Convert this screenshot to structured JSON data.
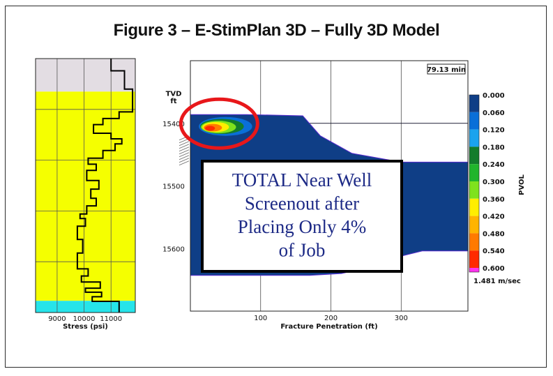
{
  "title": "Figure 3 –  E-StimPlan 3D – Fully 3D Model",
  "chart_data": [
    {
      "type": "line",
      "name": "stress-profile",
      "xlabel": "Stress (psi)",
      "ylabel": "",
      "xticks": [
        9000,
        10000,
        11000
      ],
      "xlim": [
        8200,
        11900
      ],
      "ylim": [
        15200,
        15700
      ],
      "grid": true,
      "zones": [
        {
          "from": 15200,
          "to": 15265,
          "color": "#e3dde3"
        },
        {
          "from": 15265,
          "to": 15677,
          "color": "#f5ff00"
        },
        {
          "from": 15677,
          "to": 15700,
          "color": "#26e4ea"
        }
      ],
      "step_points": [
        [
          11000,
          15200
        ],
        [
          11000,
          15224
        ],
        [
          11500,
          15224
        ],
        [
          11500,
          15260
        ],
        [
          11800,
          15260
        ],
        [
          11800,
          15305
        ],
        [
          11300,
          15305
        ],
        [
          11300,
          15318
        ],
        [
          10700,
          15318
        ],
        [
          10700,
          15330
        ],
        [
          10350,
          15330
        ],
        [
          10350,
          15347
        ],
        [
          11000,
          15347
        ],
        [
          11000,
          15358
        ],
        [
          11400,
          15358
        ],
        [
          11400,
          15368
        ],
        [
          11150,
          15368
        ],
        [
          11150,
          15381
        ],
        [
          10700,
          15381
        ],
        [
          10700,
          15396
        ],
        [
          10150,
          15396
        ],
        [
          10150,
          15408
        ],
        [
          10450,
          15408
        ],
        [
          10450,
          15420
        ],
        [
          10100,
          15420
        ],
        [
          10100,
          15440
        ],
        [
          10550,
          15440
        ],
        [
          10550,
          15457
        ],
        [
          10250,
          15457
        ],
        [
          10250,
          15475
        ],
        [
          10450,
          15475
        ],
        [
          10450,
          15490
        ],
        [
          10100,
          15490
        ],
        [
          10100,
          15506
        ],
        [
          9850,
          15506
        ],
        [
          9850,
          15515
        ],
        [
          10050,
          15515
        ],
        [
          10050,
          15530
        ],
        [
          9750,
          15530
        ],
        [
          9750,
          15556
        ],
        [
          9950,
          15556
        ],
        [
          9950,
          15583
        ],
        [
          9750,
          15583
        ],
        [
          9750,
          15614
        ],
        [
          10150,
          15614
        ],
        [
          10150,
          15628
        ],
        [
          9900,
          15628
        ],
        [
          9900,
          15640
        ],
        [
          10600,
          15640
        ],
        [
          10600,
          15652
        ],
        [
          10050,
          15652
        ],
        [
          10050,
          15660
        ],
        [
          10650,
          15660
        ],
        [
          10650,
          15669
        ],
        [
          10300,
          15669
        ],
        [
          10300,
          15678
        ],
        [
          11300,
          15678
        ],
        [
          11300,
          15700
        ]
      ]
    },
    {
      "type": "heatmap",
      "name": "fracture-contour",
      "xlabel": "Fracture Penetration (ft)",
      "ylabel": "TVD\nft",
      "xticks": [
        100,
        200,
        300
      ],
      "yticks": [
        15400,
        15500,
        15600
      ],
      "xlim": [
        0,
        395
      ],
      "ylim": [
        15300,
        15700
      ],
      "time_label": "79.13 min",
      "colorbar": {
        "label": "PVOL",
        "ticks": [
          "0.000",
          "0.060",
          "0.120",
          "0.180",
          "0.240",
          "0.300",
          "0.360",
          "0.420",
          "0.480",
          "0.540",
          "0.600"
        ],
        "colors": [
          "#0f3e86",
          "#0a6fd8",
          "#1aa3ee",
          "#137c2b",
          "#21b52c",
          "#7fe21d",
          "#ffee00",
          "#ffb400",
          "#ff7a00",
          "#ff2a00",
          "#ff33ee"
        ],
        "footer": "1.481 m/sec"
      },
      "fracture_outline": [
        [
          0,
          15386
        ],
        [
          80,
          15386
        ],
        [
          160,
          15388
        ],
        [
          185,
          15420
        ],
        [
          230,
          15448
        ],
        [
          300,
          15462
        ],
        [
          395,
          15462
        ],
        [
          395,
          15604
        ],
        [
          330,
          15604
        ],
        [
          290,
          15615
        ],
        [
          255,
          15630
        ],
        [
          215,
          15640
        ],
        [
          170,
          15643
        ],
        [
          0,
          15643
        ]
      ],
      "hotspot_bands": [
        {
          "value": 0.06,
          "color": "#0a6fd8",
          "cx": 50,
          "cy": 15405,
          "rx": 38,
          "ry": 15
        },
        {
          "value": 0.18,
          "color": "#137c2b",
          "cx": 45,
          "cy": 15405,
          "rx": 31,
          "ry": 12
        },
        {
          "value": 0.3,
          "color": "#7fe21d",
          "cx": 40,
          "cy": 15406,
          "rx": 25,
          "ry": 10
        },
        {
          "value": 0.36,
          "color": "#ffee00",
          "cx": 36,
          "cy": 15406,
          "rx": 19,
          "ry": 8
        },
        {
          "value": 0.48,
          "color": "#ff7a00",
          "cx": 32,
          "cy": 15407,
          "rx": 13,
          "ry": 6
        },
        {
          "value": 0.54,
          "color": "#ff2a00",
          "cx": 28,
          "cy": 15408,
          "rx": 7,
          "ry": 4
        }
      ],
      "annotation": {
        "lines": [
          "TOTAL Near Well",
          "Screenout after",
          "Placing Only 4%",
          "of Job"
        ]
      },
      "highlight": {
        "label": "",
        "cx": 45,
        "cy": 15405
      }
    }
  ]
}
